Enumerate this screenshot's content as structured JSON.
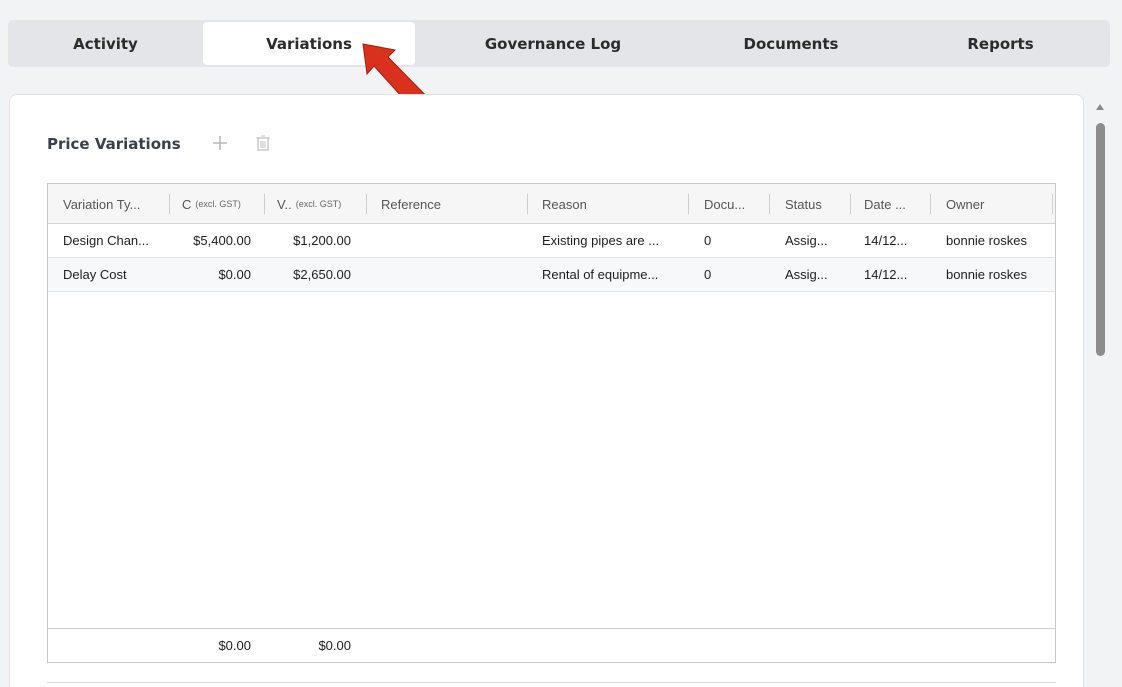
{
  "tabs": [
    {
      "label": "Activity",
      "active": false
    },
    {
      "label": "Variations",
      "active": true
    },
    {
      "label": "Governance Log",
      "active": false
    },
    {
      "label": "Documents",
      "active": false
    },
    {
      "label": "Reports",
      "active": false
    }
  ],
  "section": {
    "title": "Price Variations",
    "add_icon": "plus-icon",
    "delete_icon": "trash-icon"
  },
  "grid": {
    "columns": [
      {
        "label": "Variation Ty...",
        "sub": ""
      },
      {
        "label": "C",
        "sub": "(excl. GST)"
      },
      {
        "label": "V..",
        "sub": "(excl. GST)"
      },
      {
        "label": "Reference",
        "sub": ""
      },
      {
        "label": "Reason",
        "sub": ""
      },
      {
        "label": "Docu...",
        "sub": ""
      },
      {
        "label": "Status",
        "sub": ""
      },
      {
        "label": "Date ...",
        "sub": ""
      },
      {
        "label": "Owner",
        "sub": ""
      }
    ],
    "rows": [
      [
        "Design Chan...",
        "$5,400.00",
        "$1,200.00",
        "",
        "Existing pipes are ...",
        "0",
        "Assig...",
        "14/12...",
        "bonnie roskes"
      ],
      [
        "Delay Cost",
        "$0.00",
        "$2,650.00",
        "",
        "Rental of equipme...",
        "0",
        "Assig...",
        "14/12...",
        "bonnie roskes"
      ]
    ],
    "footer": [
      "",
      "$0.00",
      "$0.00"
    ]
  },
  "colors": {
    "accent_arrow": "#d9311e",
    "tab_bar": "#e4e5e9"
  }
}
